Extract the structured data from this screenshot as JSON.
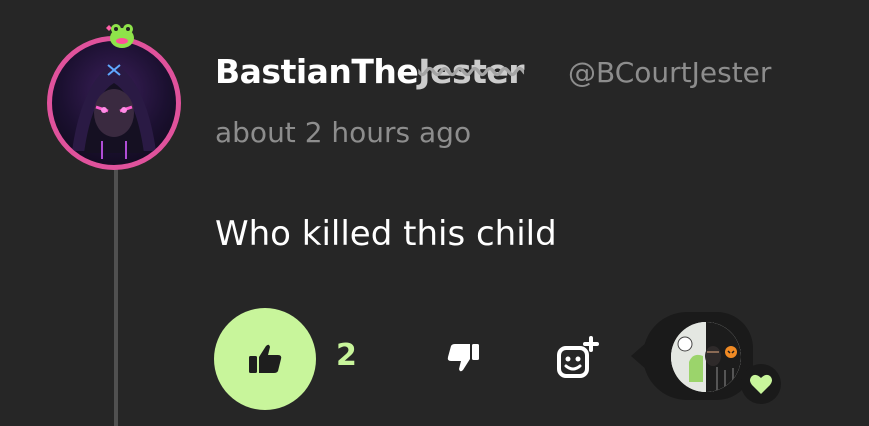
{
  "post": {
    "author": {
      "display_name_prefix": "BastianThe",
      "display_name_glitch": "Jester",
      "handle": "@BCourtJester"
    },
    "timestamp": "about 2 hours ago",
    "text": "Who killed this child"
  },
  "actions": {
    "like_count": "2",
    "like_icon": "thumbs-up-icon",
    "dislike_icon": "thumbs-down-icon",
    "react_icon": "add-reaction-icon"
  },
  "reactions": {
    "reaction_icon": "heart-icon"
  },
  "colors": {
    "background": "#262626",
    "accent_green": "#c8f59b",
    "avatar_ring": "#e0529c",
    "muted_text": "#8d8d8d"
  }
}
